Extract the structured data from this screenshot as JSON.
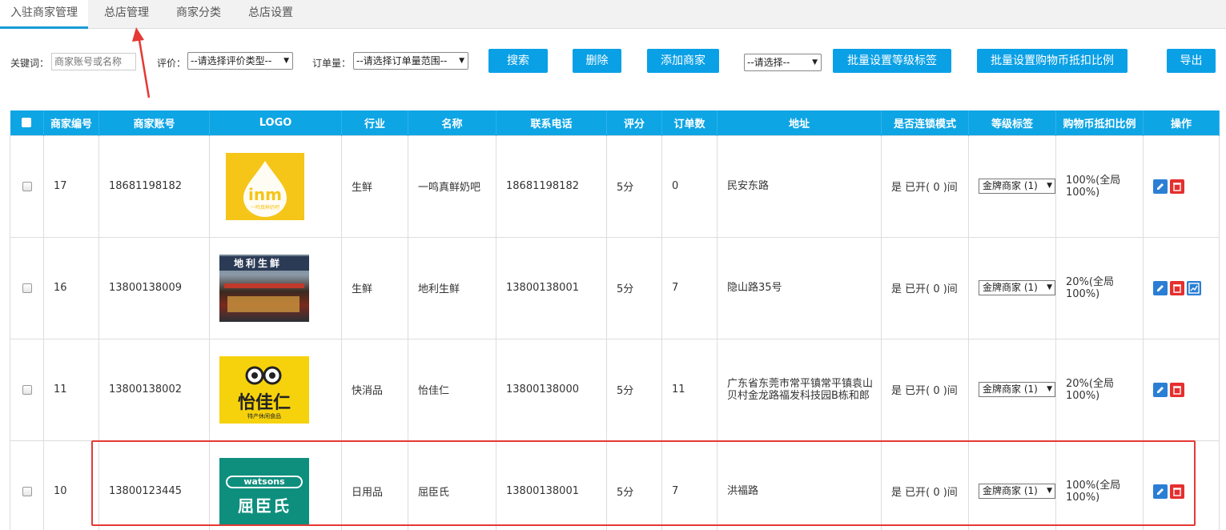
{
  "tabs": [
    "入驻商家管理",
    "总店管理",
    "商家分类",
    "总店设置"
  ],
  "filters": {
    "keyword_label": "关键词：",
    "keyword_placeholder": "商家账号或名称",
    "rating_label": "评价：",
    "rating_select": "--请选择评价类型--",
    "orders_label": "订单量：",
    "orders_select": "--请选择订单量范围--",
    "search_button": "搜索",
    "delete_button": "删除",
    "add_button": "添加商家",
    "batch_select": "--请选择--",
    "batch_level_button": "批量设置等级标签",
    "batch_ratio_button": "批量设置购物币抵扣比例",
    "export_button": "导出"
  },
  "table": {
    "headers": [
      "商家编号",
      "商家账号",
      "LOGO",
      "行业",
      "名称",
      "联系电话",
      "评分",
      "订单数",
      "地址",
      "是否连锁模式",
      "等级标签",
      "购物币抵扣比例",
      "操作"
    ],
    "rows": [
      {
        "id": "17",
        "account": "18681198182",
        "logo": "inm-logo",
        "logo_text": "inm",
        "logo_sub": "一鸣真鲜奶吧",
        "industry": "生鲜",
        "name": "一鸣真鲜奶吧",
        "phone": "18681198182",
        "rating": "5分",
        "orders": "0",
        "address": "民安东路",
        "chain": "是 已开( 0 )间",
        "level": "金牌商家 (1)",
        "ratio": "100%(全局100%)"
      },
      {
        "id": "16",
        "account": "13800138009",
        "logo": "store-photo",
        "logo_text": "地利生鲜",
        "logo_sub": "",
        "industry": "生鲜",
        "name": "地利生鲜",
        "phone": "13800138001",
        "rating": "5分",
        "orders": "7",
        "address": "隐山路35号",
        "chain": "是 已开( 0 )间",
        "level": "金牌商家 (1)",
        "ratio": "20%(全局100%)"
      },
      {
        "id": "11",
        "account": "13800138002",
        "logo": "yijiaren-logo",
        "logo_text": "怡佳仁",
        "logo_sub": "特产休闲食品",
        "industry": "快消品",
        "name": "怡佳仁",
        "phone": "13800138000",
        "rating": "5分",
        "orders": "11",
        "address": "广东省东莞市常平镇常平镇袁山贝村金龙路福发科技园B栋和郎",
        "chain": "是 已开( 0 )间",
        "level": "金牌商家 (1)",
        "ratio": "20%(全局100%)"
      },
      {
        "id": "10",
        "account": "13800123445",
        "logo": "watsons-logo",
        "logo_text": "watsons",
        "logo_sub": "屈臣氏",
        "industry": "日用品",
        "name": "屈臣氏",
        "phone": "13800138001",
        "rating": "5分",
        "orders": "7",
        "address": "洪福路",
        "chain": "是 已开( 0 )间",
        "level": "金牌商家 (1)",
        "ratio": "100%(全局100%)"
      }
    ]
  }
}
